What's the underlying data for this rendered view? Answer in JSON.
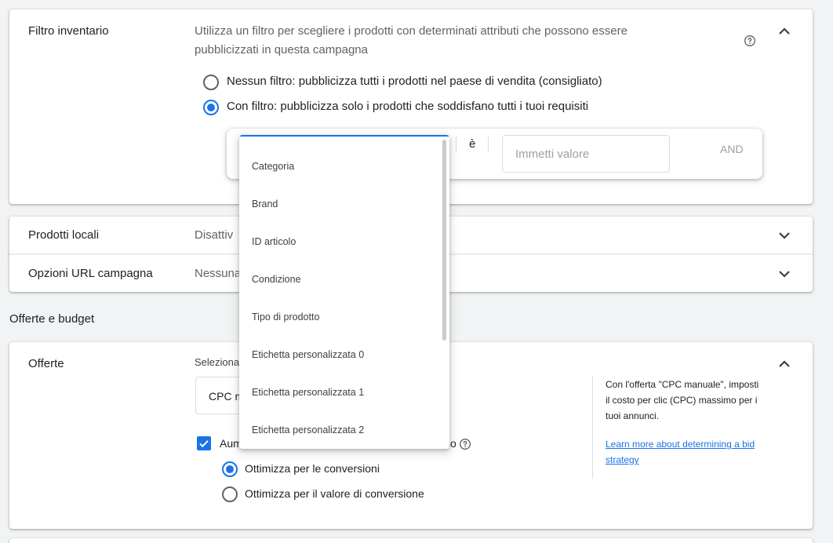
{
  "inventory": {
    "title": "Filtro inventario",
    "desc_line1": "Utilizza un filtro per scegliere i prodotti con determinati attributi che possono essere",
    "desc_line2": "pubblicizzati in questa campagna",
    "option_none": "Nessun filtro: pubblicizza tutti i prodotti nel paese di vendita (consigliato)",
    "option_filter": "Con filtro: pubblicizza solo i prodotti che soddisfano tutti i tuoi requisiti",
    "operator": "è",
    "value_placeholder": "Immetti valore",
    "and_label": "AND"
  },
  "local_products": {
    "title": "Prodotti locali",
    "value": "Disattiv"
  },
  "url_options": {
    "title": "Opzioni URL campagna",
    "value": "Nessuna"
  },
  "section_header": "Offerte e budget",
  "bids": {
    "title": "Offerte",
    "select_label": "Seleziona",
    "strategy_value": "CPC m",
    "checkbox_label": "Aum",
    "checkbox_suffix": "o",
    "opt_conversions": "Ottimizza per le conversioni",
    "opt_value": "Ottimizza per il valore di conversione",
    "aside_line1": "Con l'offerta \"CPC manuale\", imposti",
    "aside_line2": "il costo per clic (CPC) massimo per i",
    "aside_line3": "tuoi annunci.",
    "link_line1": "Learn more about determining a bid",
    "link_line2": "strategy"
  },
  "dropdown": {
    "items": [
      "Categoria",
      "Brand",
      "ID articolo",
      "Condizione",
      "Tipo di prodotto",
      "Etichetta personalizzata 0",
      "Etichetta personalizzata 1",
      "Etichetta personalizzata 2"
    ]
  },
  "colors": {
    "accent": "#1a73e8",
    "text": "#202124",
    "muted": "#5f6368",
    "background": "#f1f3f4"
  }
}
